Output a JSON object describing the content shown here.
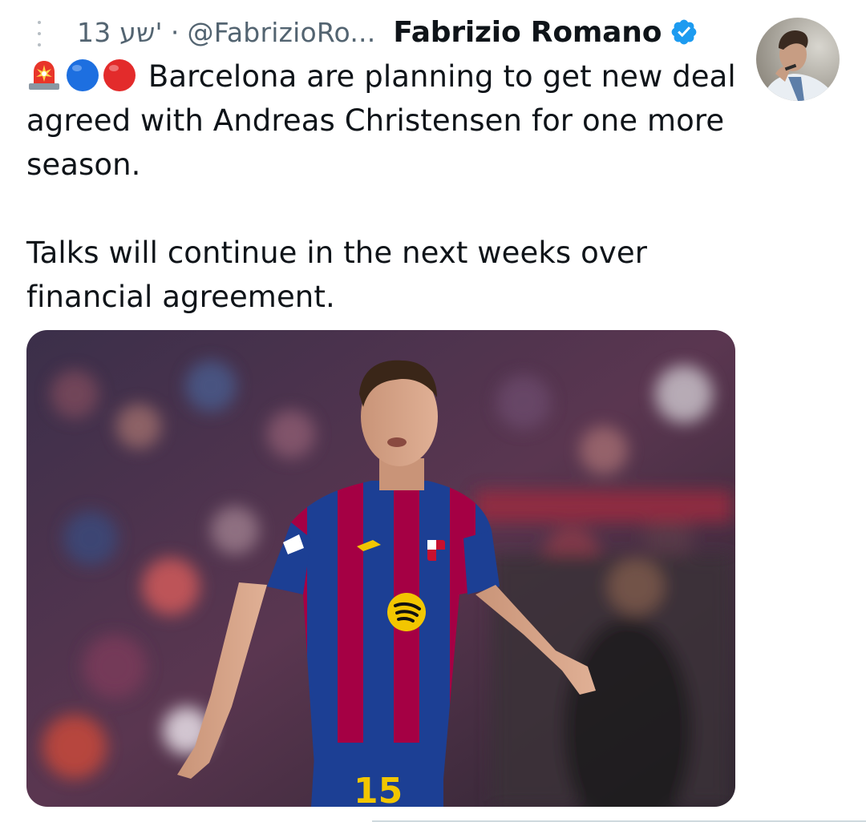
{
  "tweet": {
    "author": {
      "name": "Fabrizio Romano",
      "handle": "@FabrizioRo...",
      "avatar_icon": "avatar-photo-icon",
      "verified_icon": "verified-badge-icon",
      "verified_color": "#1d9bf0"
    },
    "timestamp": "13 שע'",
    "separator": "·",
    "emojis": [
      "siren-emoji",
      "blue-circle-emoji",
      "red-circle-emoji"
    ],
    "text_line_1": "Barcelona are planning to get new deal agreed with Andreas Christensen for one more season.",
    "text_line_2": "Talks will continue in the next weeks over financial agreement.",
    "media": {
      "type": "photo",
      "shirt_number": "15"
    }
  },
  "colors": {
    "text_primary": "#0f1419",
    "text_secondary": "#536471",
    "divider": "#cfd9de",
    "kit_blue": "#1c3f94",
    "kit_red": "#a50044"
  }
}
